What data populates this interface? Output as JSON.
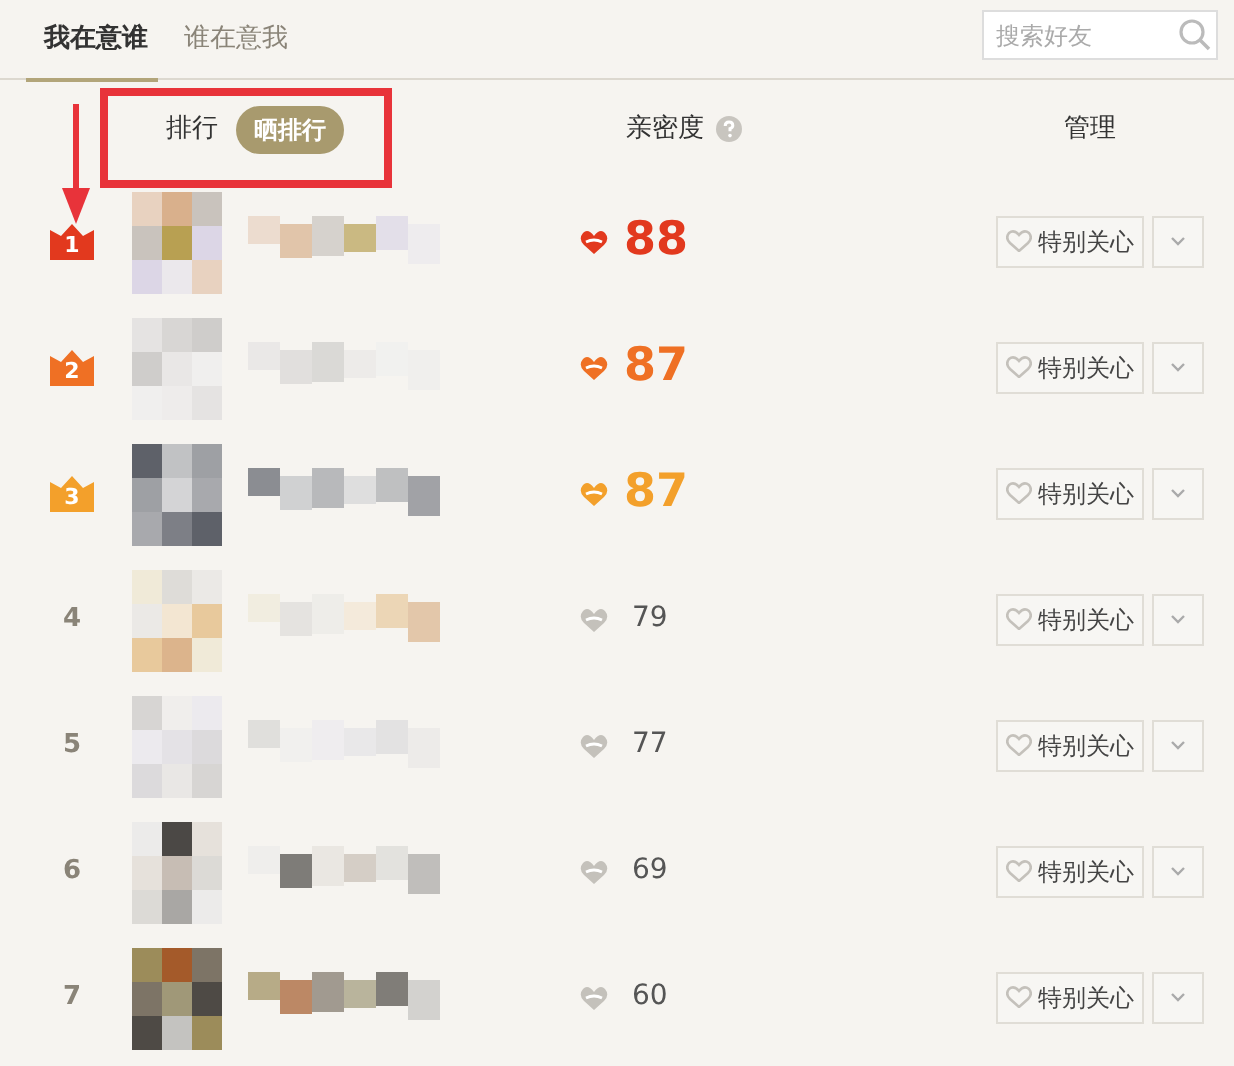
{
  "tabs": [
    {
      "label": "我在意谁",
      "selected": true
    },
    {
      "label": "谁在意我",
      "selected": false
    }
  ],
  "search": {
    "placeholder": "搜索好友"
  },
  "header": {
    "rank_label": "排行",
    "share_button": "晒排行",
    "intimacy_label": "亲密度",
    "manage_label": "管理"
  },
  "rows": [
    {
      "rank": "1",
      "kind": "crown",
      "color": "#e2391e",
      "score": "88",
      "button": "特别关心"
    },
    {
      "rank": "2",
      "kind": "crown",
      "color": "#ef7024",
      "score": "87",
      "button": "特别关心"
    },
    {
      "rank": "3",
      "kind": "crown",
      "color": "#f3a02b",
      "score": "87",
      "button": "特别关心"
    },
    {
      "rank": "4",
      "kind": "number",
      "score": "79",
      "button": "特别关心"
    },
    {
      "rank": "5",
      "kind": "number",
      "score": "77",
      "button": "特别关心"
    },
    {
      "rank": "6",
      "kind": "number",
      "score": "69",
      "button": "特别关心"
    },
    {
      "rank": "7",
      "kind": "number",
      "score": "60",
      "button": "特别关心"
    }
  ]
}
